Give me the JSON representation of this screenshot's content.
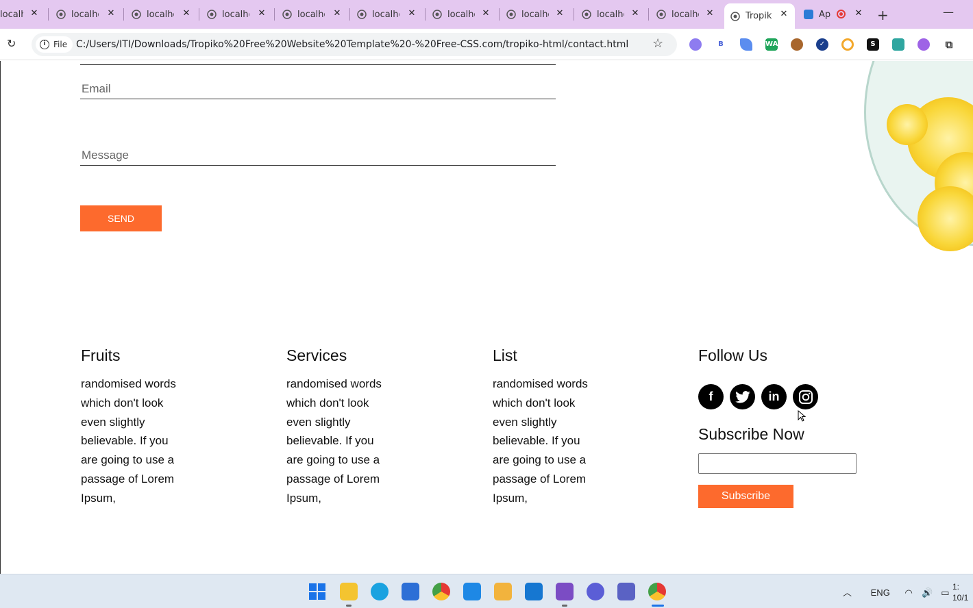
{
  "browser": {
    "tabs": [
      {
        "label": "localhost"
      },
      {
        "label": "localhost"
      },
      {
        "label": "localhost"
      },
      {
        "label": "localhost"
      },
      {
        "label": "localhost"
      },
      {
        "label": "localhost"
      },
      {
        "label": "localhost"
      },
      {
        "label": "localhost"
      },
      {
        "label": "localhost"
      },
      {
        "label": "localhost"
      },
      {
        "label": "Tropiko",
        "active": true
      },
      {
        "label": "Ap"
      }
    ],
    "new_tab_symbol": "+",
    "minimize_symbol": "—",
    "file_chip": "File",
    "url": "C:/Users/ITI/Downloads/Tropiko%20Free%20Website%20Template%20-%20Free-CSS.com/tropiko-html/contact.html",
    "extensions": [
      "puzzle-gear",
      "b",
      "feather",
      "wa",
      "cookie",
      "check",
      "ring",
      "s",
      "cast",
      "brain",
      "extensions"
    ]
  },
  "form": {
    "email_placeholder": "Email",
    "message_placeholder": "Message",
    "send_label": "SEND"
  },
  "footer": {
    "columns": [
      {
        "title": "Fruits",
        "text": "randomised words which don't look even slightly believable. If you are going to use a passage of Lorem Ipsum,"
      },
      {
        "title": "Services",
        "text": "randomised words which don't look even slightly believable. If you are going to use a passage of Lorem Ipsum,"
      },
      {
        "title": "List",
        "text": "randomised words which don't look even slightly believable. If you are going to use a passage of Lorem Ipsum,"
      }
    ],
    "follow_title": "Follow Us",
    "social": [
      {
        "icon": "facebook-icon",
        "glyph": "f"
      },
      {
        "icon": "twitter-icon",
        "glyph": "t"
      },
      {
        "icon": "linkedin-icon",
        "glyph": "in"
      },
      {
        "icon": "instagram-icon",
        "glyph": "◎"
      }
    ],
    "subscribe_title": "Subscribe Now",
    "subscribe_label": "Subscribe"
  },
  "taskbar": {
    "tray_language": "ENG",
    "clock_time": "1:",
    "clock_date": "10/1"
  },
  "colors": {
    "accent": "#fd6a2d",
    "tabstrip": "#e4c8f0",
    "taskbar": "#dfe8f2"
  }
}
